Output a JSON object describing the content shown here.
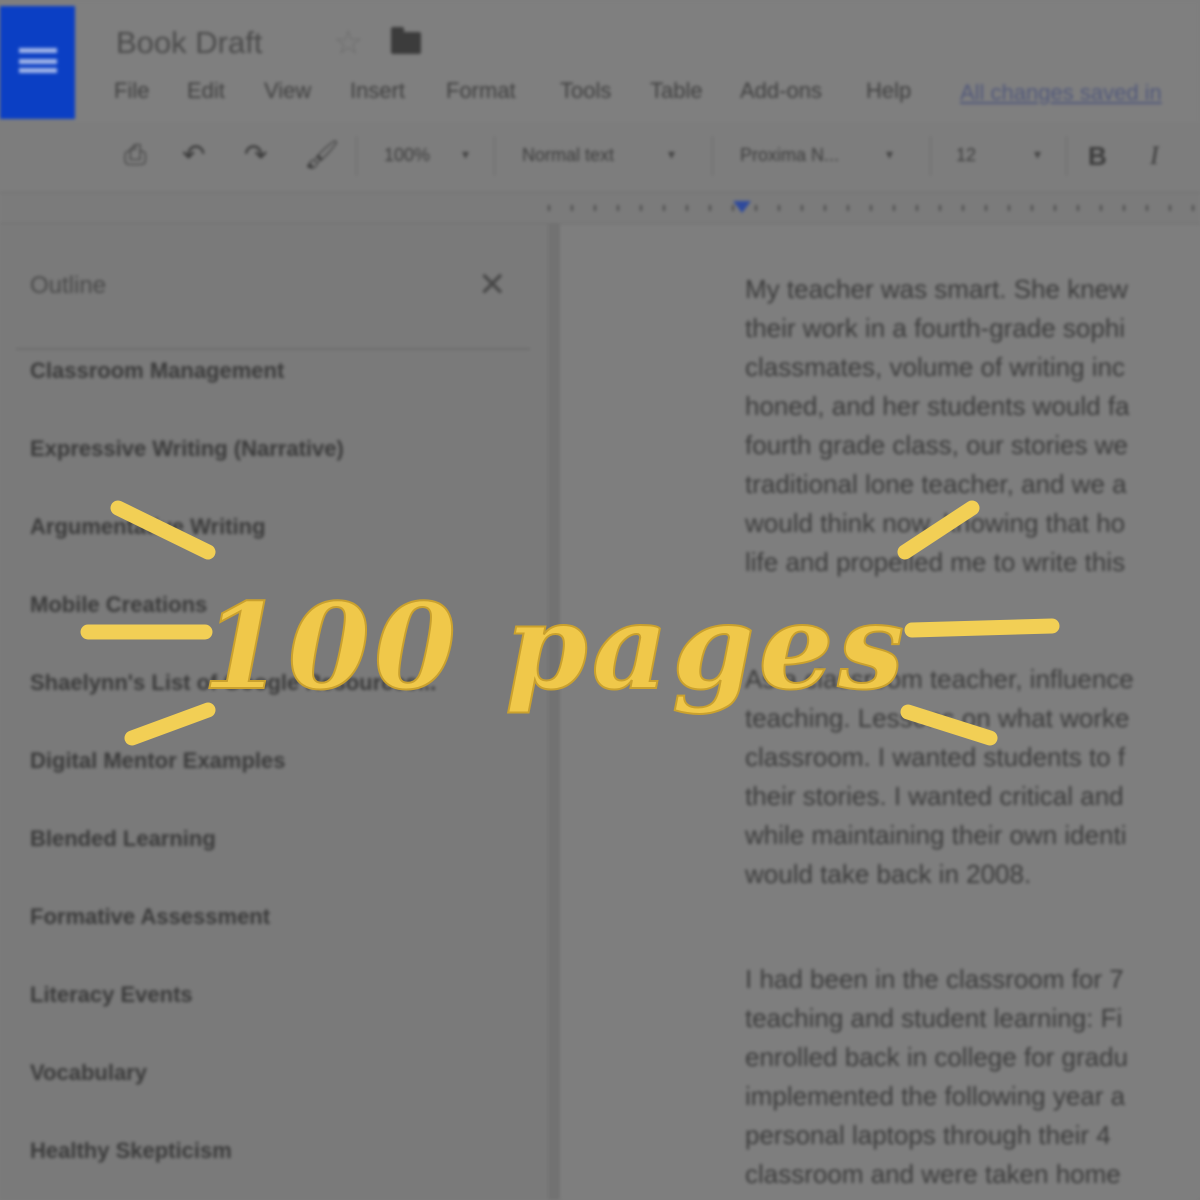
{
  "app": {
    "doc_title": "Book Draft",
    "saved_status": "All changes saved in",
    "menu": [
      "File",
      "Edit",
      "View",
      "Insert",
      "Format",
      "Tools",
      "Table",
      "Add-ons",
      "Help"
    ]
  },
  "toolbar": {
    "zoom": "100%",
    "style": "Normal text",
    "font": "Proxima N...",
    "size": "12",
    "bold": "B",
    "italic": "I"
  },
  "outline": {
    "title": "Outline",
    "items": [
      "Classroom Management",
      "Expressive Writing (Narrative)",
      "Argumentative Writing",
      "Mobile Creations",
      "Shaelynn's List of Google Resources...",
      "Digital Mentor Examples",
      "Blended Learning",
      "Formative Assessment",
      "Literacy Events",
      "Vocabulary",
      "Healthy Skepticism"
    ]
  },
  "document": {
    "paragraphs": [
      [
        "My teacher was smart. She knew",
        "their work in a fourth-grade sophi",
        "classmates, volume of writing inc",
        "honed, and her students would fa",
        "fourth grade class, our stories we",
        "traditional lone teacher, and we a",
        "would think now, knowing that ho",
        "life and propelled me to write this"
      ],
      [
        "As a classroom teacher, influence",
        "teaching. Lessons on what worke",
        "classroom. I wanted students to f",
        "their stories. I wanted critical and",
        "while maintaining their own identi",
        "would take back in 2008."
      ],
      [
        "I had been in the classroom for 7",
        "teaching and student learning: Fi",
        "enrolled back in college for gradu",
        "implemented the following year a",
        "personal laptops through their 4",
        "classroom and were taken home"
      ]
    ]
  },
  "overlay": {
    "text": "100 pages",
    "color": "#f0c84a"
  }
}
